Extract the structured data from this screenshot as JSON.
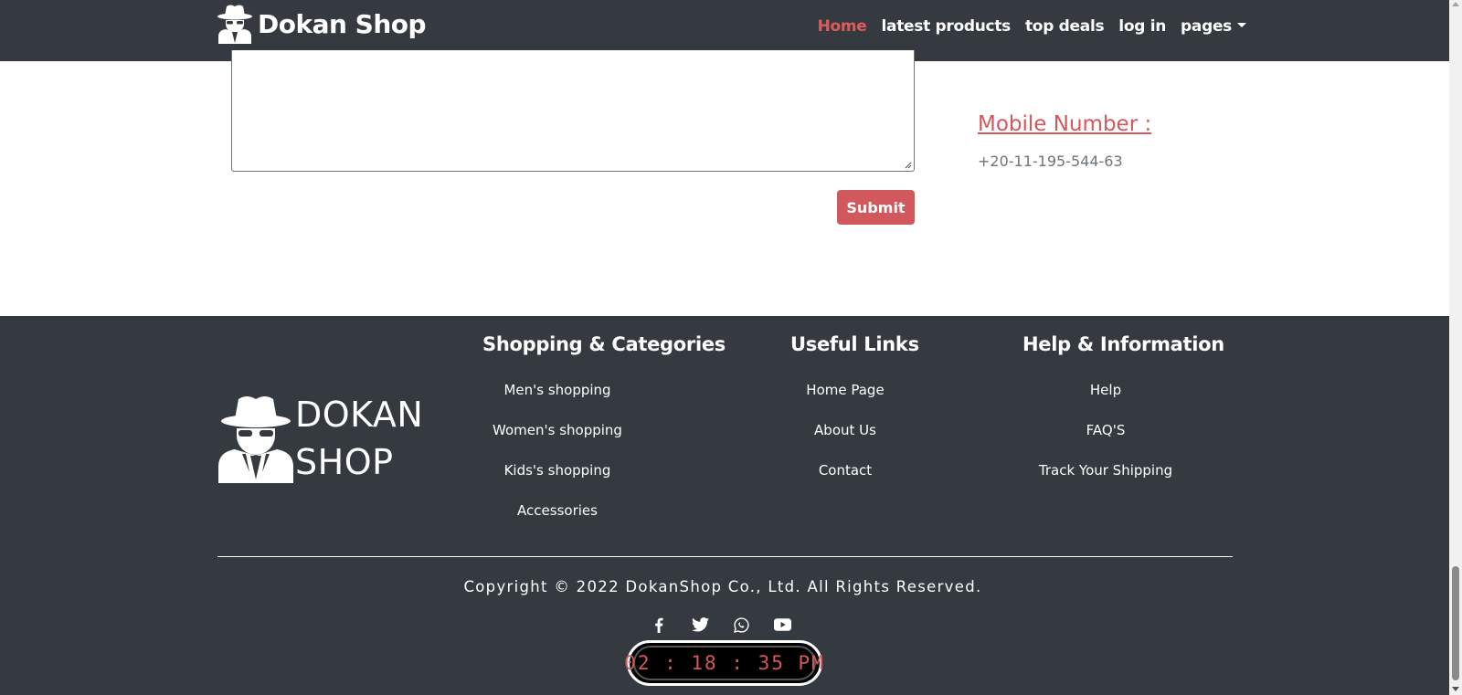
{
  "colors": {
    "nav_bg": "#343a40",
    "accent": "#d1585c",
    "text_muted": "#6c757d"
  },
  "navbar": {
    "brand": "Dokan Shop",
    "brand_icon": "spy-icon",
    "links": [
      {
        "label": "Home",
        "active": true
      },
      {
        "label": "latest products",
        "active": false
      },
      {
        "label": "top deals",
        "active": false
      },
      {
        "label": "log in",
        "active": false
      },
      {
        "label": "pages",
        "active": false,
        "dropdown": true
      }
    ]
  },
  "contact_form": {
    "message_value": "",
    "submit_label": "Submit"
  },
  "contact_info": {
    "mobile_title": "Mobile Number :",
    "mobile_value": "+20-11-195-544-63"
  },
  "footer": {
    "logo_line1": "DOKAN",
    "logo_line2": "SHOP",
    "logo_icon": "spy-icon",
    "columns": [
      {
        "title": "Shopping & Categories",
        "links": [
          "Men's shopping",
          "Women's shopping",
          "Kids's shopping",
          "Accessories"
        ]
      },
      {
        "title": "Useful Links",
        "links": [
          "Home Page",
          "About Us",
          "Contact"
        ]
      },
      {
        "title": "Help & Information",
        "links": [
          "Help",
          "FAQ'S",
          "Track Your Shipping"
        ]
      }
    ],
    "copyright": "Copyright © 2022 DokanShop Co., Ltd. All Rights Reserved.",
    "socials": [
      "facebook-icon",
      "twitter-icon",
      "whatsapp-icon",
      "youtube-icon"
    ],
    "clock": "02 : 18 : 35 PM"
  }
}
